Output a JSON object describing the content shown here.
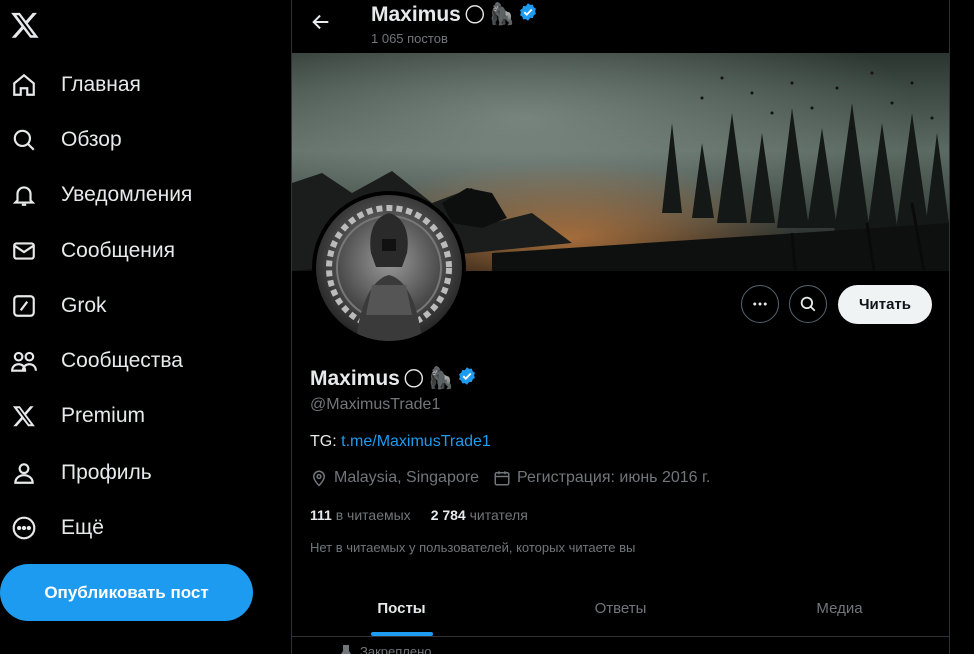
{
  "sidebar": {
    "items": [
      {
        "label": "Главная",
        "icon": "home-icon"
      },
      {
        "label": "Обзор",
        "icon": "search-icon"
      },
      {
        "label": "Уведомления",
        "icon": "bell-icon"
      },
      {
        "label": "Сообщения",
        "icon": "mail-icon"
      },
      {
        "label": "Grok",
        "icon": "grok-icon"
      },
      {
        "label": "Сообщества",
        "icon": "communities-icon"
      },
      {
        "label": "Premium",
        "icon": "x-premium-icon"
      },
      {
        "label": "Профиль",
        "icon": "person-icon"
      },
      {
        "label": "Ещё",
        "icon": "more-circle-icon"
      }
    ],
    "post_button": "Опубликовать пост"
  },
  "header": {
    "name": "Maximus",
    "emoji": "🌕",
    "emoji2": "🦍",
    "posts_count": "1 065 постов"
  },
  "profile": {
    "name": "Maximus",
    "emoji": "🌕",
    "emoji2": "🦍",
    "handle": "@MaximusTrade1",
    "bio_prefix": "TG:",
    "bio_link": "t.me/MaximusTrade1",
    "location": "Malaysia, Singapore",
    "joined": "Регистрация: июнь 2016 г.",
    "following_count": "111",
    "following_label": "в читаемых",
    "followers_count": "2 784",
    "followers_label": "читателя",
    "followed_by_note": "Нет в читаемых у пользователей, которых читаете вы",
    "follow_button": "Читать"
  },
  "tabs": [
    {
      "label": "Посты",
      "active": true
    },
    {
      "label": "Ответы",
      "active": false
    },
    {
      "label": "Медиа",
      "active": false
    }
  ],
  "pinned_label": "Закреплено",
  "colors": {
    "accent": "#1d9bf0",
    "background": "#000000",
    "muted_text": "#71767b",
    "border": "#2f3336"
  }
}
